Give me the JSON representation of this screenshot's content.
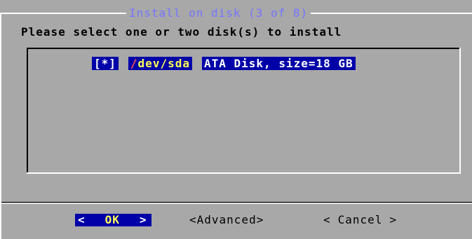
{
  "dialog": {
    "title": "Install on disk (3 of 8)",
    "prompt": "Please select one or two disk(s) to install"
  },
  "disks": [
    {
      "checkbox": "[*]",
      "device_first_char": "/",
      "device_rest": "dev/sda",
      "description": "ATA Disk, size=18 GB",
      "selected": true
    }
  ],
  "buttons": {
    "ok": {
      "open": "<",
      "label": "OK",
      "close": ">"
    },
    "advanced": {
      "label": "<Advanced>"
    },
    "cancel": {
      "open": "<",
      "label": "Cancel",
      "close": ">"
    }
  },
  "colors": {
    "background": "#a8a8a8",
    "title": "#7474ff",
    "highlight": "#0000a8",
    "hotkey": "#ff5555",
    "selected_text": "#ffff55"
  }
}
